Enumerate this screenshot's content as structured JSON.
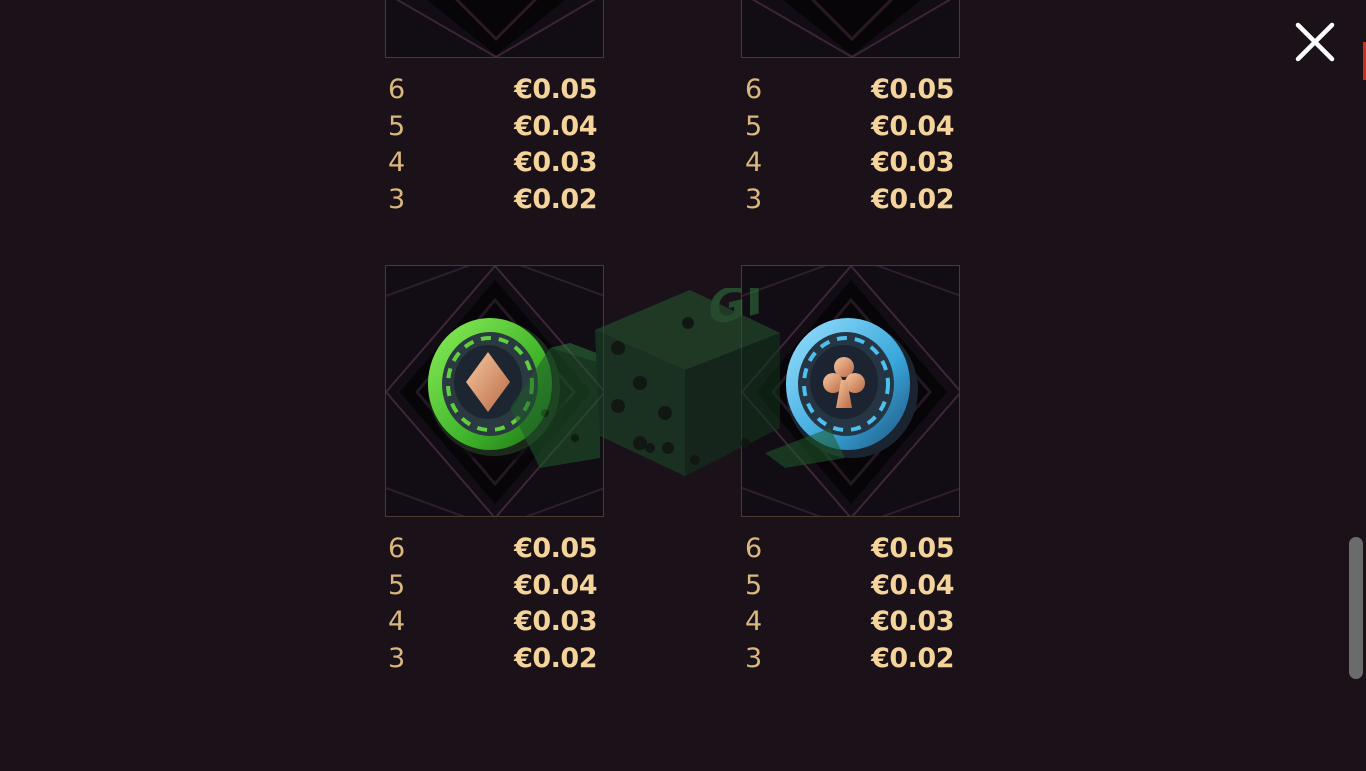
{
  "close_icon": "close-icon",
  "symbols": [
    {
      "name": "top-left-symbol",
      "icon": "partial-card",
      "paytable": [
        {
          "count": "6",
          "amount": "€0.05"
        },
        {
          "count": "5",
          "amount": "€0.04"
        },
        {
          "count": "4",
          "amount": "€0.03"
        },
        {
          "count": "3",
          "amount": "€0.02"
        }
      ]
    },
    {
      "name": "top-right-symbol",
      "icon": "partial-card",
      "paytable": [
        {
          "count": "6",
          "amount": "€0.05"
        },
        {
          "count": "5",
          "amount": "€0.04"
        },
        {
          "count": "4",
          "amount": "€0.03"
        },
        {
          "count": "3",
          "amount": "€0.02"
        }
      ]
    },
    {
      "name": "green-diamond-chip",
      "icon": "green-diamond-chip-icon",
      "paytable": [
        {
          "count": "6",
          "amount": "€0.05"
        },
        {
          "count": "5",
          "amount": "€0.04"
        },
        {
          "count": "4",
          "amount": "€0.03"
        },
        {
          "count": "3",
          "amount": "€0.02"
        }
      ]
    },
    {
      "name": "blue-club-chip",
      "icon": "blue-club-chip-icon",
      "paytable": [
        {
          "count": "6",
          "amount": "€0.05"
        },
        {
          "count": "5",
          "amount": "€0.04"
        },
        {
          "count": "4",
          "amount": "€0.03"
        },
        {
          "count": "3",
          "amount": "€0.02"
        }
      ]
    }
  ],
  "colors": {
    "background": "#1a1119",
    "count_text": "#d9b77e",
    "amount_text": "#f4d49a",
    "card_border": "#4a3a33",
    "green_chip": "#5ad13a",
    "blue_chip": "#3fb6e8",
    "scrollbar_thumb": "#6b6b6b"
  }
}
